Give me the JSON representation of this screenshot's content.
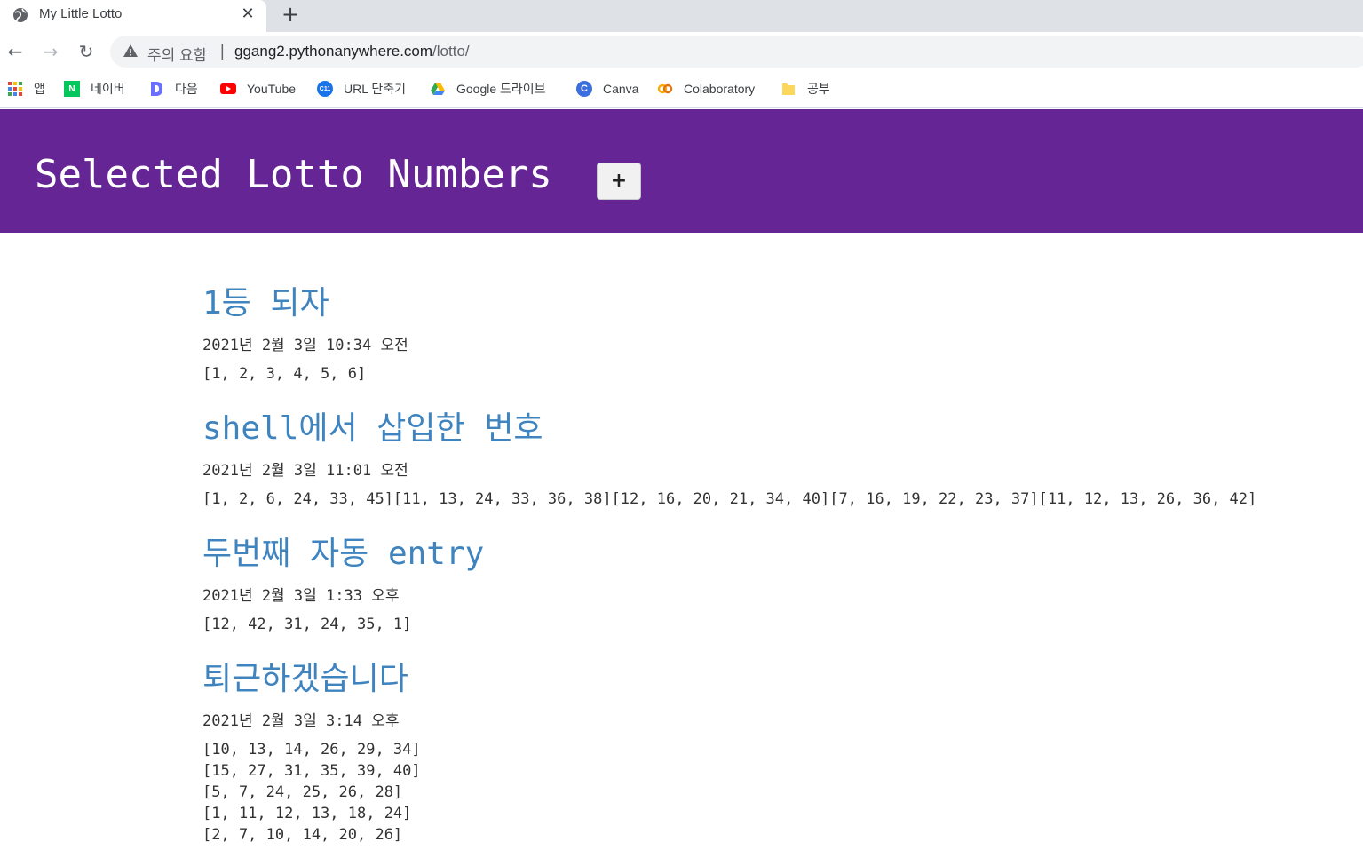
{
  "browser": {
    "tab_title": "My Little Lotto",
    "security_label": "주의 요함",
    "url_domain": "ggang2.pythonanywhere.com",
    "url_path": "/lotto/"
  },
  "bookmarks": [
    {
      "label": "앱",
      "icon": "apps-grid-icon"
    },
    {
      "label": "네이버",
      "icon": "naver-icon",
      "color": "#03c75a"
    },
    {
      "label": "다음",
      "icon": "daum-icon",
      "color": "#6b6fff"
    },
    {
      "label": "YouTube",
      "icon": "youtube-icon",
      "color": "#ff0000"
    },
    {
      "label": "URL 단축기",
      "icon": "url-shortener-icon",
      "color": "#1a73e8"
    },
    {
      "label": "Google 드라이브",
      "icon": "google-drive-icon"
    },
    {
      "label": "Canva",
      "icon": "canva-icon",
      "color": "#3b6fe0"
    },
    {
      "label": "Colaboratory",
      "icon": "colab-icon",
      "color": "#f9ab00"
    },
    {
      "label": "공부",
      "icon": "folder-icon",
      "color": "#fbd75b"
    }
  ],
  "header": {
    "title": "Selected Lotto Numbers",
    "add_label": "+",
    "background": "#662594"
  },
  "posts": [
    {
      "title": "1등 되자",
      "date": "2021년 2월 3일 10:34 오전",
      "lines": [
        "[1, 2, 3, 4, 5, 6]"
      ]
    },
    {
      "title": "shell에서 삽입한 번호",
      "date": "2021년 2월 3일 11:01 오전",
      "lines": [
        "[1, 2, 6, 24, 33, 45][11, 13, 24, 33, 36, 38][12, 16, 20, 21, 34, 40][7, 16, 19, 22, 23, 37][11, 12, 13, 26, 36, 42]"
      ]
    },
    {
      "title": "두번째 자동 entry",
      "date": "2021년 2월 3일 1:33 오후",
      "lines": [
        "[12, 42, 31, 24, 35, 1]"
      ]
    },
    {
      "title": "퇴근하겠습니다",
      "date": "2021년 2월 3일 3:14 오후",
      "lines": [
        "[10, 13, 14, 26, 29, 34]",
        "[15, 27, 31, 35, 39, 40]",
        "[5, 7, 24, 25, 26, 28]",
        "[1, 11, 12, 13, 18, 24]",
        "[2, 7, 10, 14, 20, 26]"
      ]
    }
  ]
}
